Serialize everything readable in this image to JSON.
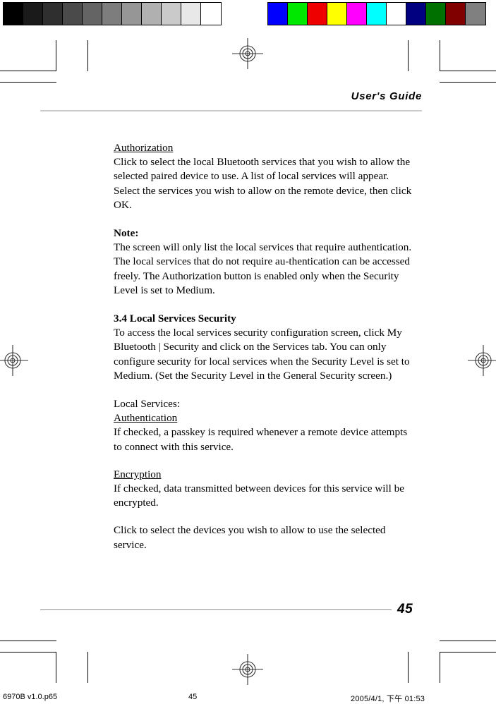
{
  "prepress": {
    "grayscale_bar": {
      "name": "grayscale-calibration-bar",
      "swatches": [
        "#000000",
        "#1a1a1a",
        "#2f2f2f",
        "#4a4a4a",
        "#646464",
        "#7d7d7d",
        "#969696",
        "#b0b0b0",
        "#cacaca",
        "#e8e8e8",
        "#ffffff"
      ]
    },
    "color_bar": {
      "name": "color-calibration-bar",
      "swatches": [
        "#0000ff",
        "#00e800",
        "#ee0000",
        "#ffff00",
        "#ff00ff",
        "#00ffff",
        "#ffffff",
        "#000080",
        "#007000",
        "#800000",
        "#808080"
      ]
    }
  },
  "header": {
    "title": "User's Guide"
  },
  "footer": {
    "page_number": "45"
  },
  "content": {
    "sections": [
      {
        "heading": "Authorization",
        "heading_style": "underline",
        "body": "Click to select the local Bluetooth services that you wish to allow the selected  paired device to use. A list of local services will appear. Select the services you wish to allow on the remote device, then click OK."
      },
      {
        "heading": "Note:",
        "heading_style": "bold",
        "body": "The screen will only list the local services that require authentication. The local services that do not require au-thentication can be accessed freely. The Authorization button is enabled only when the Security Level is set to Medium."
      },
      {
        "heading": "3.4 Local Services Security",
        "heading_style": "bold",
        "body": "To access the local services security configuration screen, click My Bluetooth | Security and click on the Services tab. You can only configure security for local services when the Security Level is set to Medium. (Set the Security Level in the General Security screen.)"
      },
      {
        "heading": "Local Services:",
        "heading_style": "plain",
        "body": ""
      },
      {
        "heading": "Authentication",
        "heading_style": "underline",
        "body": "If checked, a passkey is required whenever a remote device attempts to connect with this service."
      },
      {
        "heading": "Encryption",
        "heading_style": "underline",
        "body": "If checked, data transmitted between devices for this service will be encrypted."
      },
      {
        "heading": "",
        "heading_style": "plain",
        "body": " Click to select the devices you wish to allow to use the selected service."
      }
    ]
  },
  "app_footer": {
    "filename": "6970B v1.0.p65",
    "page": "45",
    "timestamp": "2005/4/1, 下午 01:53"
  }
}
